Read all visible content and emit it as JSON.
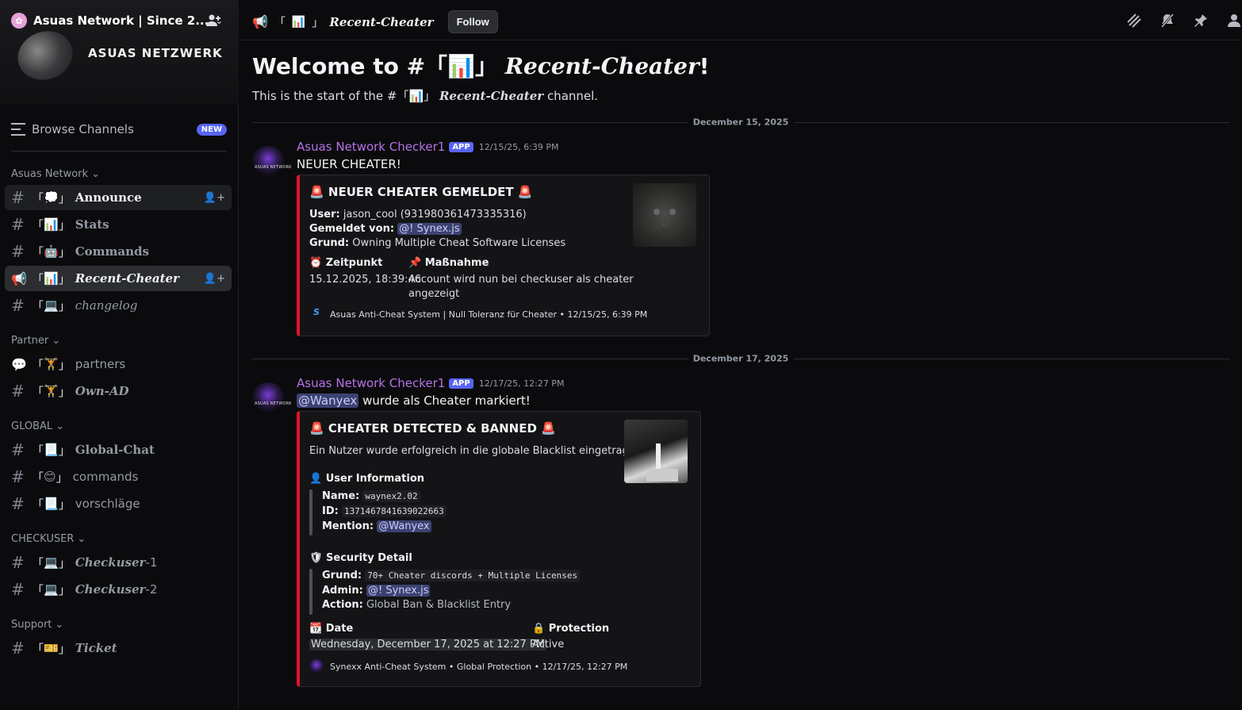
{
  "server": {
    "name": "Asuas Network | Since 2...",
    "banner_title": "ASUAS NETZWERK"
  },
  "sidebar": {
    "browse_label": "Browse Channels",
    "new_badge": "NEW",
    "categories": [
      {
        "label": "Asuas Network"
      },
      {
        "label": "Partner"
      },
      {
        "label": "GLOBAL"
      },
      {
        "label": "CHECKUSER"
      },
      {
        "label": "Support"
      }
    ],
    "channels": [
      {
        "prefix": "「",
        "emoji": "💭",
        "suffix": "」",
        "label": "Announce"
      },
      {
        "prefix": "「",
        "emoji": "📊",
        "suffix": "」",
        "label": "Stats"
      },
      {
        "prefix": "「",
        "emoji": "🤖",
        "suffix": "」",
        "label": "Commands"
      },
      {
        "prefix": "「",
        "emoji": "📊",
        "suffix": "」",
        "label": "Recent-Cheater"
      },
      {
        "prefix": "「",
        "emoji": "💻",
        "suffix": "」",
        "label": "changelog"
      },
      {
        "prefix": "「",
        "emoji": "🏋",
        "suffix": "」",
        "label": "partners"
      },
      {
        "prefix": "「",
        "emoji": "🏋",
        "suffix": "」",
        "label": "Own-AD"
      },
      {
        "prefix": "「",
        "emoji": "📃",
        "suffix": "」",
        "label": "Global-Chat"
      },
      {
        "prefix": "「",
        "emoji": "😊",
        "suffix": "」",
        "label": "commands"
      },
      {
        "prefix": "「",
        "emoji": "📃",
        "suffix": "」",
        "label": "vorschläge"
      },
      {
        "prefix": "「",
        "emoji": "💻",
        "suffix": "」",
        "label": "Checkuser",
        "tail": "-1"
      },
      {
        "prefix": "「",
        "emoji": "💻",
        "suffix": "」",
        "label": "Checkuser",
        "tail": "-2"
      },
      {
        "prefix": "「",
        "emoji": "🎫",
        "suffix": "」",
        "label": "Ticket"
      }
    ]
  },
  "topbar": {
    "channel_prefix": "「",
    "channel_emoji": "📊",
    "channel_suffix": "」",
    "channel_name": "Recent-Cheater",
    "follow_label": "Follow"
  },
  "main": {
    "welcome_prefix": "Welcome to #「",
    "welcome_emoji": "📊",
    "welcome_suffix": "」",
    "welcome_channel": "Recent-Cheater",
    "welcome_end": "!",
    "start_prefix": "This is the start of the #「",
    "start_emoji": "📊",
    "start_suffix": "」",
    "start_channel": "Recent-Cheater",
    "start_end": " channel."
  },
  "messages": [
    {
      "date_divider": "December 15, 2025",
      "author": "Asuas Network Checker1",
      "badge": "APP",
      "timestamp": "12/15/25, 6:39 PM",
      "avatar_text": "ASUAS NETWORK",
      "text": "NEUER CHEATER!",
      "embed": {
        "siren": "🚨",
        "title": "NEUER CHEATER GEMELDET",
        "user_label": "User:",
        "user_value": "jason_cool (931980361473335316)",
        "reporter_label": "Gemeldet von:",
        "reporter_value": "@! Synex.js",
        "reason_label": "Grund:",
        "reason_value": "Owning Multiple Cheat Software Licenses",
        "time_icon": "⏰",
        "time_name": "Zeitpunkt",
        "time_value": "15.12.2025, 18:39:46",
        "action_icon": "📌",
        "action_name": "Maßnahme",
        "action_value_1": "Account wird nun bei checkuser als cheater",
        "action_value_2": "angezeigt",
        "footer": "Asuas Anti-Cheat System | Null Toleranz für Cheater • 12/15/25, 6:39 PM"
      }
    },
    {
      "date_divider": "December 17, 2025",
      "author": "Asuas Network Checker1",
      "badge": "APP",
      "timestamp": "12/17/25, 12:27 PM",
      "avatar_text": "ASUAS NETWORK",
      "mention": "@Wanyex",
      "text": " wurde als Cheater markiert!",
      "embed": {
        "siren": "🚨",
        "title": "CHEATER DETECTED & BANNED",
        "description": "Ein Nutzer wurde erfolgreich in die globale Blacklist eingetragen.",
        "user_info_icon": "👤",
        "user_info_title": "User Information",
        "name_label": "Name:",
        "name_value": "waynex2.02",
        "id_label": "ID:",
        "id_value": "1371467841639022663",
        "mention_label": "Mention:",
        "mention_value": "@Wanyex",
        "security_icon": "🛡",
        "security_title": "Security Detail",
        "grund_label": "Grund:",
        "grund_value": "70+ Cheater discords + Multiple Licenses",
        "admin_label": "Admin:",
        "admin_value": "@! Synex.js",
        "action_label": "Action:",
        "action_value": "Global Ban & Blacklist Entry",
        "date_icon": "📆",
        "date_name": "Date",
        "date_value": "Wednesday, December 17, 2025 at 12:27 PM",
        "protection_icon": "🔒",
        "protection_name": "Protection",
        "protection_value": "Active",
        "footer": "Synexx Anti-Cheat System • Global Protection • 12/17/25, 12:27 PM"
      }
    }
  ],
  "colors": {
    "accent": "#5865f2",
    "embed_border": "#e0142d",
    "username": "#b573e6"
  }
}
